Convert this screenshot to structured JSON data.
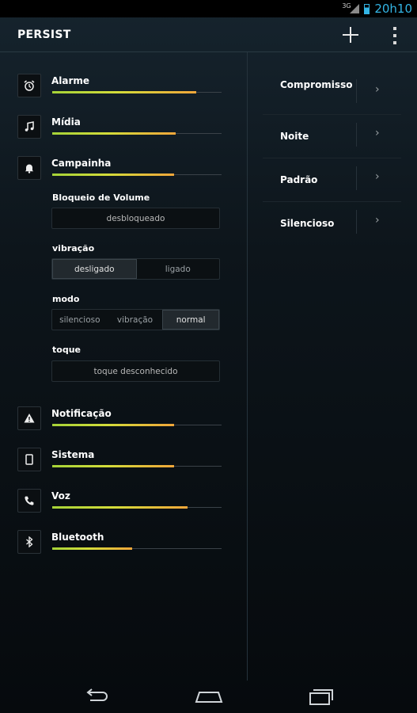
{
  "statusbar": {
    "network": "3G",
    "time": "20h10"
  },
  "actionbar": {
    "title": "PERSIST"
  },
  "volumes": [
    {
      "name": "alarm",
      "label": "Alarme",
      "icon": "alarm-clock-icon",
      "level": 0.85
    },
    {
      "name": "media",
      "label": "Mídia",
      "icon": "music-note-icon",
      "level": 0.73
    },
    {
      "name": "ringer",
      "label": "Campainha",
      "icon": "bell-icon",
      "level": 0.72
    },
    {
      "name": "notification",
      "label": "Notificação",
      "icon": "warning-icon",
      "level": 0.72
    },
    {
      "name": "system",
      "label": "Sistema",
      "icon": "phone-icon",
      "level": 0.72
    },
    {
      "name": "voice",
      "label": "Voz",
      "icon": "handset-icon",
      "level": 0.8
    },
    {
      "name": "bluetooth",
      "label": "Bluetooth",
      "icon": "bluetooth-icon",
      "level": 0.47
    }
  ],
  "ringer_options": {
    "lock": {
      "label": "Bloqueio de Volume",
      "value": "desbloqueado"
    },
    "vibration": {
      "label": "vibração",
      "options": [
        "desligado",
        "ligado"
      ],
      "selected": "desligado"
    },
    "mode": {
      "label": "modo",
      "options": [
        "silencioso",
        "vibração",
        "normal"
      ],
      "selected": "normal"
    },
    "ringtone": {
      "label": "toque",
      "value": "toque desconhecido"
    }
  },
  "profiles": [
    {
      "label": "Compromisso"
    },
    {
      "label": "Noite"
    },
    {
      "label": "Padrão"
    },
    {
      "label": "Silencioso"
    }
  ],
  "colors": {
    "accent": "#33b5e5",
    "bar_start": "#a6d338",
    "bar_end": "#f0a63a"
  }
}
